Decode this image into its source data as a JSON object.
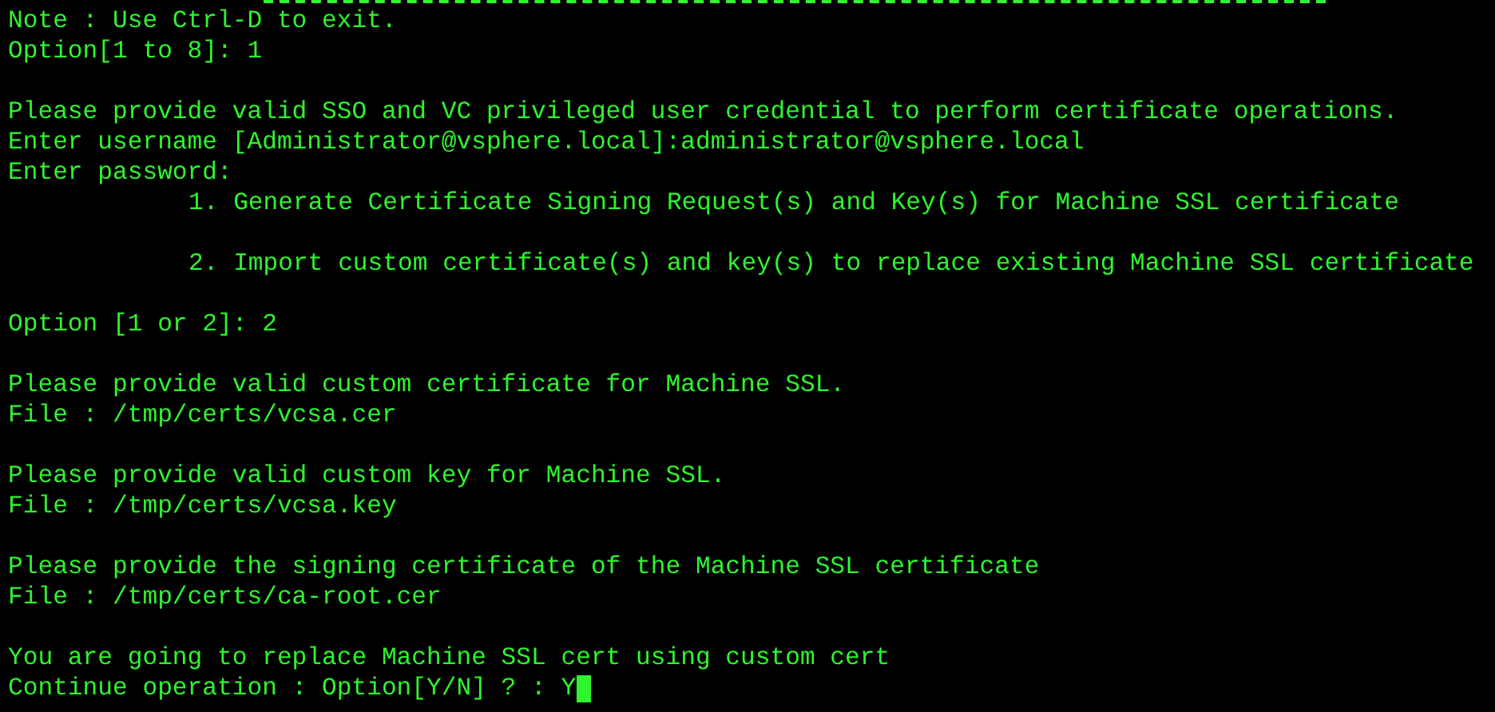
{
  "terminal": {
    "lines": [
      {
        "kind": "text",
        "text": "Note : Use Ctrl-D to exit."
      },
      {
        "kind": "text",
        "text": "Option[1 to 8]: 1"
      },
      {
        "kind": "blank"
      },
      {
        "kind": "text",
        "text": "Please provide valid SSO and VC privileged user credential to perform certificate operations."
      },
      {
        "kind": "text",
        "text": "Enter username [Administrator@vsphere.local]:administrator@vsphere.local"
      },
      {
        "kind": "text",
        "text": "Enter password:"
      },
      {
        "kind": "menu",
        "text": "1. Generate Certificate Signing Request(s) and Key(s) for Machine SSL certificate"
      },
      {
        "kind": "blank"
      },
      {
        "kind": "menu",
        "text": "2. Import custom certificate(s) and key(s) to replace existing Machine SSL certificate"
      },
      {
        "kind": "blank"
      },
      {
        "kind": "text",
        "text": "Option [1 or 2]: 2"
      },
      {
        "kind": "blank"
      },
      {
        "kind": "text",
        "text": "Please provide valid custom certificate for Machine SSL."
      },
      {
        "kind": "text",
        "text": "File : /tmp/certs/vcsa.cer"
      },
      {
        "kind": "blank"
      },
      {
        "kind": "text",
        "text": "Please provide valid custom key for Machine SSL."
      },
      {
        "kind": "text",
        "text": "File : /tmp/certs/vcsa.key"
      },
      {
        "kind": "blank"
      },
      {
        "kind": "text",
        "text": "Please provide the signing certificate of the Machine SSL certificate"
      },
      {
        "kind": "text",
        "text": "File : /tmp/certs/ca-root.cer"
      },
      {
        "kind": "blank"
      },
      {
        "kind": "text",
        "text": "You are going to replace Machine SSL cert using custom cert"
      },
      {
        "kind": "text",
        "text": "Continue operation : Option[Y/N] ? : Y",
        "cursor": true
      }
    ]
  }
}
